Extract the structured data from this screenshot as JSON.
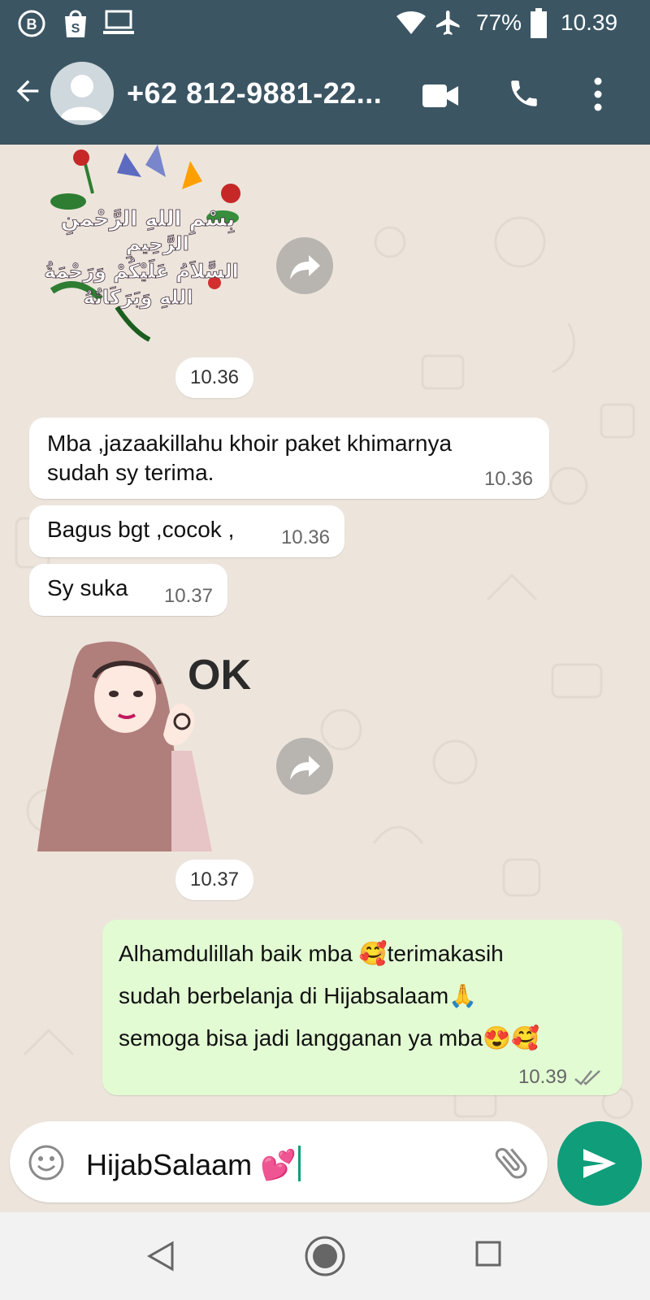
{
  "status_bar": {
    "battery": "77%",
    "time": "10.39",
    "icons": [
      "b-icon",
      "shopee-icon",
      "laptop-icon",
      "wifi-icon",
      "airplane-icon",
      "battery-icon"
    ]
  },
  "header": {
    "contact": "+62 812-9881-22...",
    "icons": [
      "back-arrow-icon",
      "avatar-icon",
      "video-call-icon",
      "phone-icon",
      "more-vert-icon"
    ]
  },
  "messages": {
    "m1_time": "10.36",
    "m2_text_line1": "Mba ,jazaakillahu khoir paket khimarnya",
    "m2_text_line2": "sudah sy terima.",
    "m2_time": "10.36",
    "m3_text": "Bagus bgt ,cocok ,",
    "m3_time": "10.36",
    "m4_text": "Sy suka",
    "m4_time": "10.37",
    "m5_sticker_text": "OK",
    "m5_time": "10.37",
    "m6_line1": "Alhamdulillah baik mba 🥰terimakasih",
    "m6_line2": "sudah berbelanja di Hijabsalaam🙏",
    "m6_line3": "semoga bisa jadi langganan ya mba😍🥰",
    "m6_time": "10.39",
    "sticker1_arabic_line1": "بِسْمِ اللهِ الرَّحْمنِ",
    "sticker1_arabic_line2": "الرَّحِيمِ",
    "sticker1_arabic_line3": "السَّلاَمُ عَلَيْكُمْ وَرَحْمَةُ",
    "sticker1_arabic_line4": "اللهِ وَبَرَكَاتُهُ"
  },
  "composer": {
    "text": "HijabSalaam 💕"
  },
  "colors": {
    "header": "#3b5563",
    "send": "#0f9d7a",
    "outgoing_bubble": "#e2fbd3"
  }
}
